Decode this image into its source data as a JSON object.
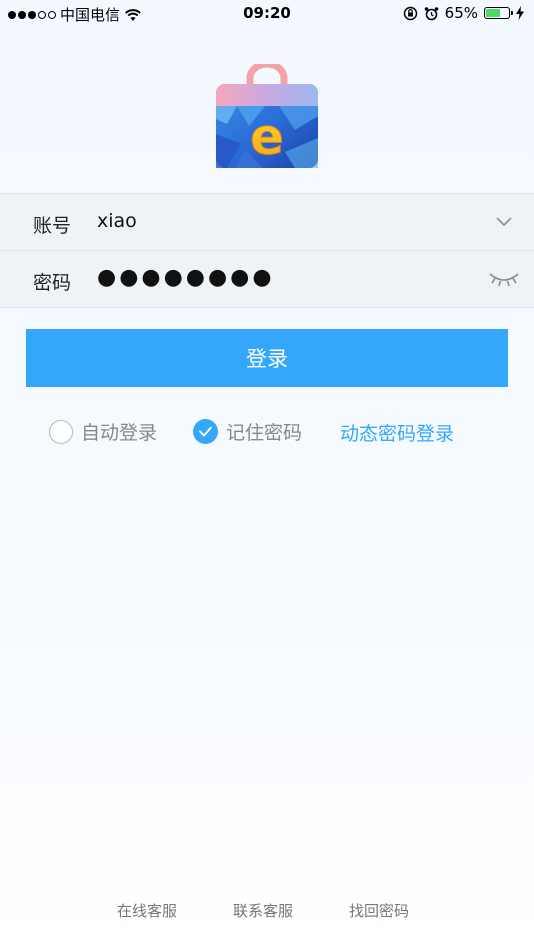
{
  "status_bar": {
    "carrier": "中国电信",
    "time": "09:20",
    "battery": "65%",
    "battery_level": 0.65,
    "icons": [
      "signal-icon",
      "wifi-icon",
      "orientation-lock-icon",
      "alarm-icon",
      "battery-icon",
      "charging-icon"
    ]
  },
  "logo": {
    "letter": "e",
    "icon": "shopping-bag-logo-icon"
  },
  "form": {
    "account_label": "账号",
    "account_value": "xiao",
    "password_label": "密码",
    "password_value": "●●●●●●●●",
    "account_dropdown_icon": "chevron-down-icon",
    "password_toggle_icon": "eye-closed-icon"
  },
  "login_button": "登录",
  "options": {
    "auto_login": "自动登录",
    "auto_login_checked": false,
    "remember_password": "记住密码",
    "remember_password_checked": true,
    "dynamic_password_login": "动态密码登录"
  },
  "footer": {
    "online_service": "在线客服",
    "contact_service": "联系客服",
    "find_password": "找回密码"
  },
  "colors": {
    "accent": "#35a7fb",
    "row_background": "#eef3f7",
    "battery_green": "#4cd964"
  }
}
